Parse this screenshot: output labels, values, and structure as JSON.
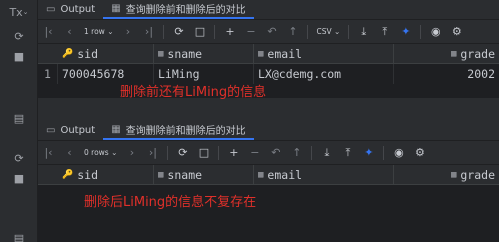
{
  "sidebar": {
    "tx_label": "Tx",
    "items": [
      "Tx",
      "⟳",
      "■",
      "▤",
      "⟳",
      "■"
    ]
  },
  "panel1": {
    "tab_output": "Output",
    "tab_result": "查询删除前和删除后的对比",
    "rows_label": "1 row",
    "format_label": "CSV",
    "columns": [
      "sid",
      "sname",
      "email",
      "grade"
    ],
    "rows": [
      {
        "num": "1",
        "sid": "700045678",
        "sname": "LiMing",
        "email": "LX@cdemg.com",
        "grade": "2002"
      }
    ],
    "note": "删除前还有LiMing的信息"
  },
  "panel2": {
    "tab_output": "Output",
    "tab_result": "查询删除前和删除后的对比",
    "rows_label": "0 rows",
    "columns": [
      "sid",
      "sname",
      "email",
      "grade"
    ],
    "note": "删除后LiMing的信息不复存在"
  },
  "colors": {
    "background": "#1e1f22",
    "panel": "#2b2d30",
    "accent": "#3574f0",
    "annotation": "#e0302a"
  }
}
